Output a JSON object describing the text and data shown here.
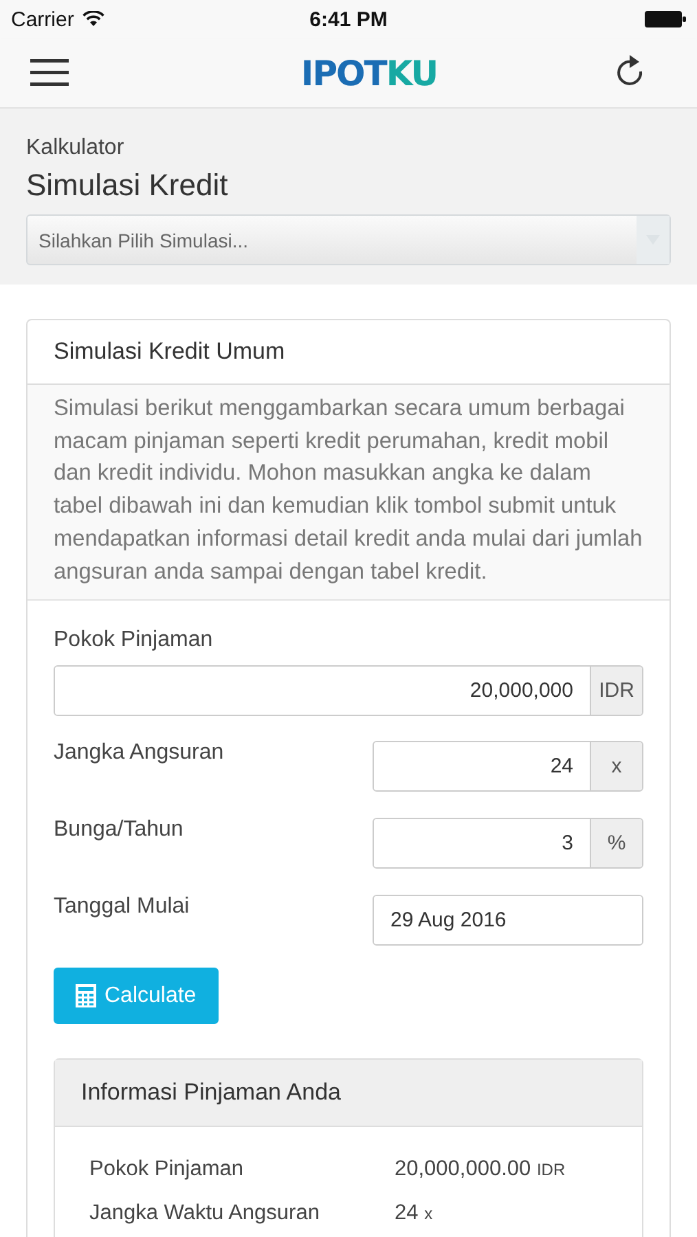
{
  "status_bar": {
    "carrier": "Carrier",
    "time": "6:41 PM"
  },
  "nav": {
    "logo": [
      {
        "text": "IPOT",
        "color": "#1b6db4"
      },
      {
        "text": "KU",
        "color": "#17a9a3"
      }
    ]
  },
  "header": {
    "subtitle": "Kalkulator",
    "title": "Simulasi Kredit",
    "select": {
      "placeholder": "Silahkan Pilih Simulasi..."
    }
  },
  "card": {
    "title": "Simulasi Kredit Umum",
    "description": "Simulasi berikut menggambarkan secara umum berbagai macam pinjaman seperti kredit perumahan, kredit mobil dan kredit individu. Mohon masukkan angka ke dalam tabel dibawah ini dan kemudian klik tombol submit untuk mendapatkan informasi detail kredit anda mulai dari jumlah angsuran anda sampai dengan tabel kredit.",
    "fields": [
      {
        "kind": "stacked",
        "label": "Pokok Pinjaman",
        "value": "20,000,000",
        "addon": "IDR"
      },
      {
        "kind": "inline",
        "label": "Jangka Angsuran",
        "value": "24",
        "addon": "x"
      },
      {
        "kind": "inline",
        "label": "Bunga/Tahun",
        "value": "3",
        "addon": "%"
      },
      {
        "kind": "inline",
        "label": "Tanggal Mulai",
        "value": "29 Aug 2016"
      }
    ],
    "button": "Calculate",
    "info": {
      "title": "Informasi Pinjaman Anda",
      "rows": [
        {
          "label": "Pokok Pinjaman",
          "value": "20,000,000.00",
          "unit": "IDR"
        },
        {
          "label": "Jangka Waktu Angsuran",
          "value": "24",
          "unit": "x"
        }
      ]
    }
  }
}
